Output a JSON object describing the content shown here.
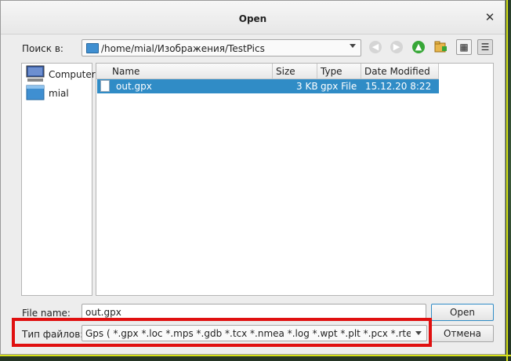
{
  "dialog": {
    "title": "Open"
  },
  "toolbar": {
    "look_in_label": "Поиск в:",
    "path": "/home/mial/Изображения/TestPics",
    "back_icon": "arrow-left-icon",
    "forward_icon": "arrow-right-icon",
    "up_icon": "arrow-up-icon",
    "new_folder_icon": "new-folder-icon",
    "list_view_icon": "list-view-icon",
    "detail_view_icon": "detail-view-icon"
  },
  "sidebar": {
    "items": [
      {
        "label": "Computer",
        "icon": "computer-icon"
      },
      {
        "label": "mial",
        "icon": "folder-icon"
      }
    ]
  },
  "file_list": {
    "columns": [
      "Name",
      "Size",
      "Type",
      "Date Modified"
    ],
    "rows": [
      {
        "name": "out.gpx",
        "size": "3 KB",
        "type": "gpx File",
        "date": "15.12.20 8:22",
        "selected": true
      }
    ]
  },
  "footer": {
    "file_name_label": "File name:",
    "file_name_value": "out.gpx",
    "file_type_label": "Тип файлов:",
    "file_type_value": "Gps ( *.gpx *.loc *.mps *.gdb *.tcx *.nmea *.log *.wpt *.plt *.pcx *.rte *.upt *.geo",
    "open_button": "Open",
    "cancel_button": "Отмена"
  },
  "colors": {
    "selection": "#308cc6",
    "highlight_border": "#e01010",
    "window_bg": "#ededed"
  }
}
